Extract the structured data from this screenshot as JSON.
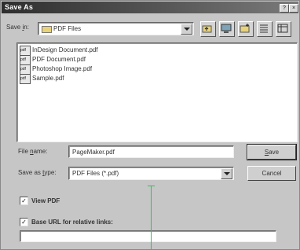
{
  "window": {
    "title": "Save As"
  },
  "save_in": {
    "label_prefix": "Save ",
    "label_accel": "i",
    "label_suffix": "n:",
    "value": "PDF Files"
  },
  "toolbar": {
    "icons": [
      "up-folder-icon",
      "desktop-icon",
      "new-folder-icon",
      "list-view-icon",
      "details-view-icon"
    ]
  },
  "files": [
    {
      "name": "InDesign Document.pdf"
    },
    {
      "name": "PDF Document.pdf"
    },
    {
      "name": "Photoshop Image.pdf"
    },
    {
      "name": "Sample.pdf"
    }
  ],
  "file_name": {
    "label_prefix": "File ",
    "label_accel": "n",
    "label_suffix": "ame:",
    "value": "PageMaker.pdf"
  },
  "save_as_type": {
    "label_prefix": "Save as ",
    "label_accel": "t",
    "label_suffix": "ype:",
    "value": "PDF Files (*.pdf)"
  },
  "buttons": {
    "save_accel": "S",
    "save_rest": "ave",
    "cancel": "Cancel"
  },
  "options": {
    "view_pdf": {
      "label": "View PDF",
      "checked": true
    },
    "base_url": {
      "label": "Base URL for relative links:",
      "checked": true,
      "value": ""
    }
  }
}
